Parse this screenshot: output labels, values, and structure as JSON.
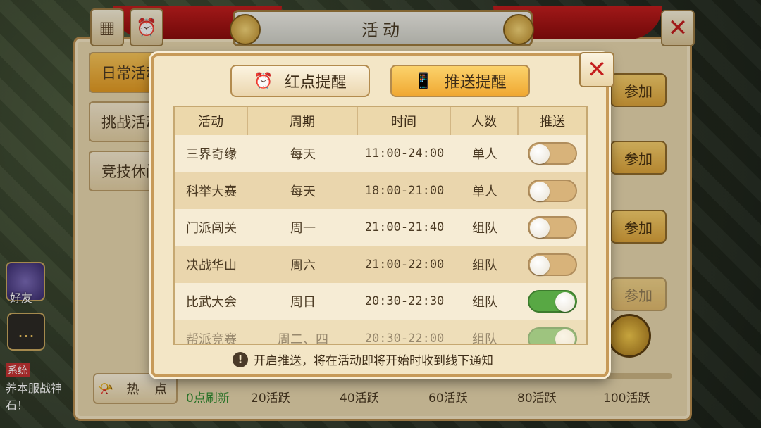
{
  "window": {
    "title": "活动",
    "close_icon": "close-icon"
  },
  "sidebar": {
    "items": [
      {
        "label": "日常活动",
        "active": true
      },
      {
        "label": "挑战活动",
        "active": false
      },
      {
        "label": "竞技休闲",
        "active": false
      }
    ]
  },
  "join_buttons": [
    "参加",
    "参加",
    "参加",
    "参加"
  ],
  "footer": {
    "hot_label": "热 点",
    "refresh_label": "0点刷新",
    "milestones": [
      "20活跃",
      "40活跃",
      "60活跃",
      "80活跃",
      "100活跃"
    ]
  },
  "left_hud": {
    "friends_label": "好友",
    "system_tag": "系统",
    "chat_line1": "养本服战神",
    "chat_line2": "石！"
  },
  "dialog": {
    "tab_red_dot": "红点提醒",
    "tab_push": "推送提醒",
    "active_tab": "推送提醒",
    "columns": [
      "活动",
      "周期",
      "时间",
      "人数",
      "推送"
    ],
    "rows": [
      {
        "name": "三界奇缘",
        "period": "每天",
        "time": "11:00-24:00",
        "mode": "单人",
        "push": false
      },
      {
        "name": "科举大赛",
        "period": "每天",
        "time": "18:00-21:00",
        "mode": "单人",
        "push": false
      },
      {
        "name": "门派闯关",
        "period": "周一",
        "time": "21:00-21:40",
        "mode": "组队",
        "push": false
      },
      {
        "name": "决战华山",
        "period": "周六",
        "time": "21:00-22:00",
        "mode": "组队",
        "push": false
      },
      {
        "name": "比武大会",
        "period": "周日",
        "time": "20:30-22:30",
        "mode": "组队",
        "push": true
      },
      {
        "name": "帮派竞赛",
        "period": "周二、四",
        "time": "20:30-22:00",
        "mode": "组队",
        "push": true
      }
    ],
    "notice": "开启推送，将在活动即将开始时收到线下通知"
  },
  "colors": {
    "toggle_on": "#58a844",
    "toggle_off": "#d8b37a",
    "accent": "#f0a832",
    "close_red": "#c41e1e"
  }
}
